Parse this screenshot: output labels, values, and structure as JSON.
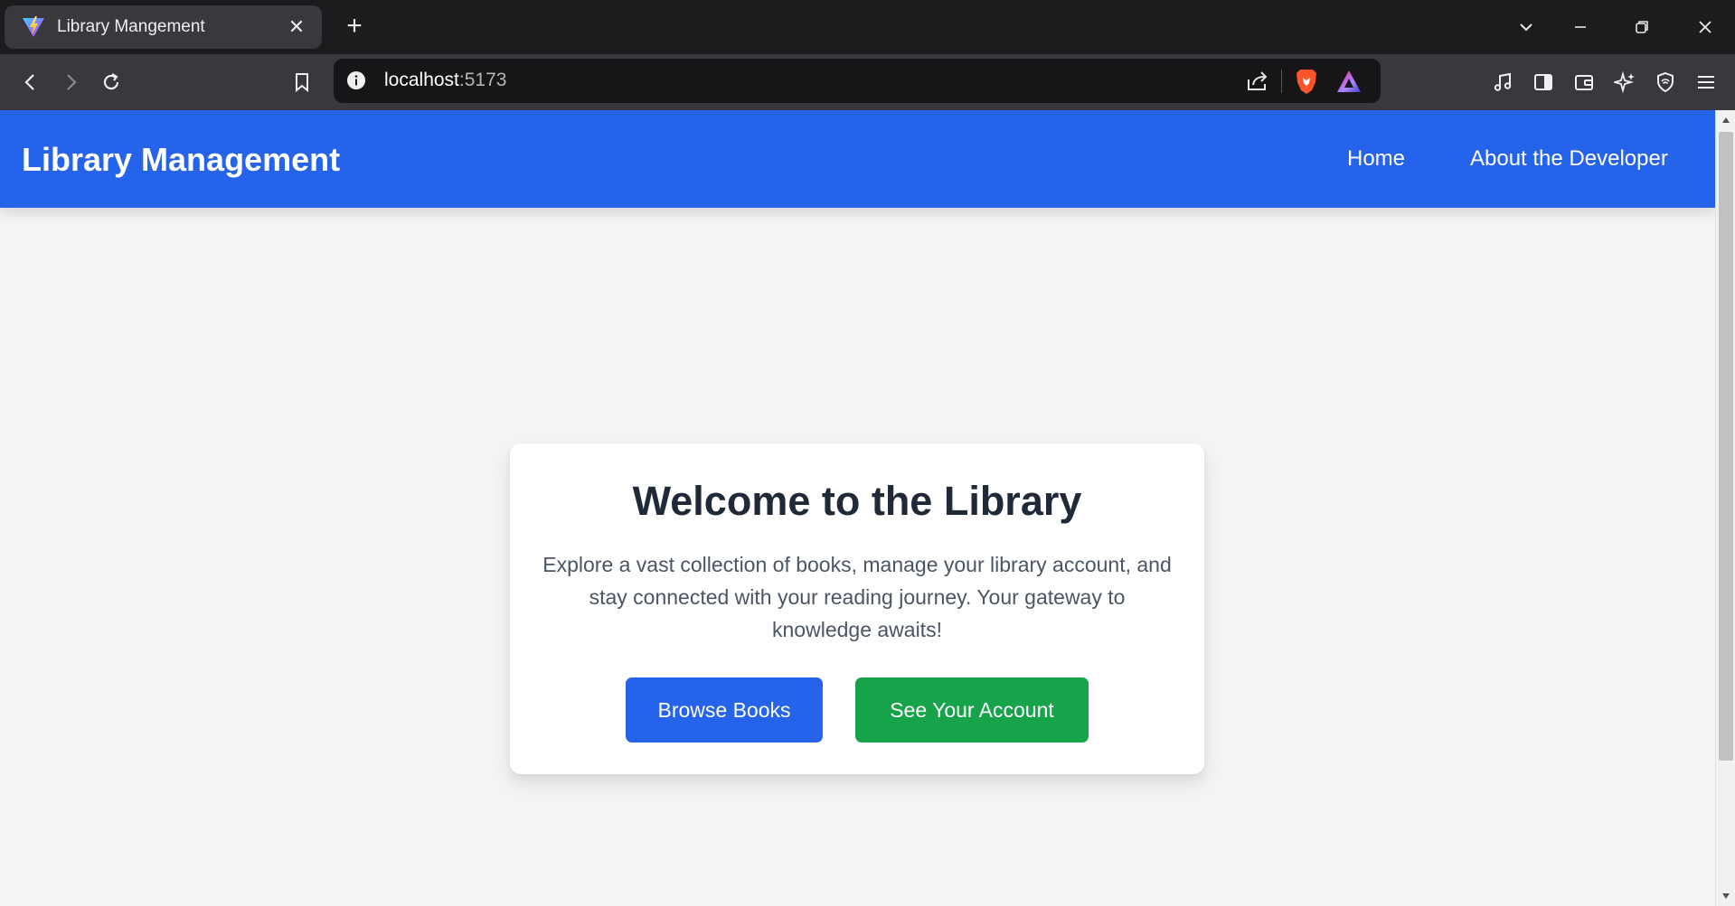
{
  "browser": {
    "tab_title": "Library Mangement",
    "tab_close": "✕",
    "new_tab": "+",
    "url_host": "localhost",
    "url_port": ":5173"
  },
  "navbar": {
    "brand": "Library Management",
    "links": [
      "Home",
      "About the Developer"
    ]
  },
  "hero": {
    "title": "Welcome to the Library",
    "description": "Explore a vast collection of books, manage your library account, and stay connected with your reading journey. Your gateway to knowledge awaits!",
    "buttons": {
      "browse": "Browse Books",
      "account": "See Your Account"
    }
  },
  "colors": {
    "navbar": "#2563eb",
    "browse_button": "#2563eb",
    "account_button": "#16a34a",
    "page_background": "#f3f4f6",
    "title_text": "#1f2937",
    "body_text": "#4b5563"
  },
  "icons": {
    "favicon": "vite-icon",
    "tabs_dropdown": "chevron-down-icon",
    "minimize": "minimize-icon",
    "restore": "restore-icon",
    "close": "close-icon",
    "back": "back-arrow-icon",
    "forward": "forward-arrow-icon",
    "reload": "reload-icon",
    "bookmark": "bookmark-icon",
    "site_info": "info-icon",
    "share": "share-icon",
    "brave_shields": "brave-lion-icon",
    "brave_rewards": "rewards-triangle-icon",
    "music": "music-note-icon",
    "sidebar": "sidebar-icon",
    "wallet": "wallet-icon",
    "leo": "sparkle-icon",
    "vpn": "shield-icon",
    "menu": "hamburger-menu-icon"
  }
}
